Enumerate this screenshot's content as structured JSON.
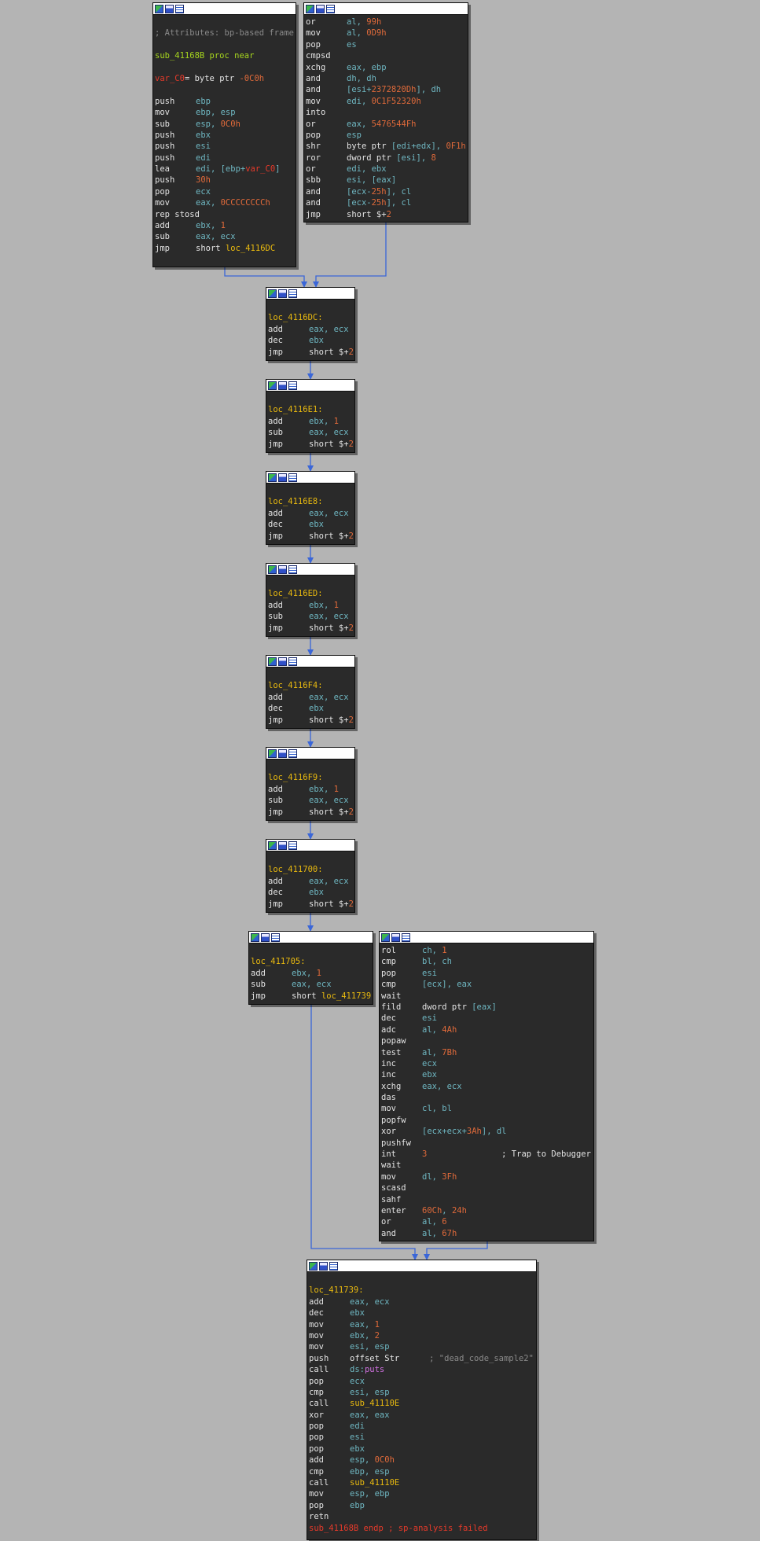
{
  "colors": {
    "background": "#b4b4b4",
    "node_bg": "#2a2a2a",
    "edge": "#3a66d8",
    "mnemonic": "#e4e4e4",
    "operand": "#6fb7c2",
    "number": "#e06a3a",
    "label": "#e8b90f",
    "comment": "#8a8a8a"
  },
  "titlebar_icons": [
    "graph-overview-icon",
    "flow-chart-icon",
    "text-view-icon"
  ],
  "blocks": {
    "entry": [
      [],
      [
        [
          "cmt",
          "; Attributes: bp-based frame"
        ]
      ],
      [],
      [
        [
          "lime",
          "sub_41168B proc near"
        ]
      ],
      [],
      [
        [
          "red",
          "var_C0"
        ],
        [
          "white",
          "= byte ptr "
        ],
        [
          "num",
          "-0C0h"
        ]
      ],
      [],
      [
        [
          "mn",
          "push"
        ],
        [
          "op",
          "ebp"
        ]
      ],
      [
        [
          "mn",
          "mov"
        ],
        [
          "op",
          "ebp, esp"
        ]
      ],
      [
        [
          "mn",
          "sub"
        ],
        [
          "op",
          "esp, "
        ],
        [
          "num",
          "0C0h"
        ]
      ],
      [
        [
          "mn",
          "push"
        ],
        [
          "op",
          "ebx"
        ]
      ],
      [
        [
          "mn",
          "push"
        ],
        [
          "op",
          "esi"
        ]
      ],
      [
        [
          "mn",
          "push"
        ],
        [
          "op",
          "edi"
        ]
      ],
      [
        [
          "mn",
          "lea"
        ],
        [
          "op",
          "edi, [ebp+"
        ],
        [
          "red",
          "var_C0"
        ],
        [
          "op",
          "]"
        ]
      ],
      [
        [
          "mn",
          "push"
        ],
        [
          "num",
          "30h"
        ]
      ],
      [
        [
          "mn",
          "pop"
        ],
        [
          "op",
          "ecx"
        ]
      ],
      [
        [
          "mn",
          "mov"
        ],
        [
          "op",
          "eax, "
        ],
        [
          "num",
          "0CCCCCCCCh"
        ]
      ],
      [
        [
          "white",
          "rep stosd"
        ]
      ],
      [
        [
          "mn",
          "add"
        ],
        [
          "op",
          "ebx, "
        ],
        [
          "num",
          "1"
        ]
      ],
      [
        [
          "mn",
          "sub"
        ],
        [
          "op",
          "eax, ecx"
        ]
      ],
      [
        [
          "mn",
          "jmp"
        ],
        [
          "white",
          "short "
        ],
        [
          "lbl",
          "loc_4116DC"
        ]
      ]
    ],
    "junk_top": [
      [
        [
          "mn",
          "or"
        ],
        [
          "op",
          "al, "
        ],
        [
          "num",
          "99h"
        ]
      ],
      [
        [
          "mn",
          "mov"
        ],
        [
          "op",
          "al, "
        ],
        [
          "num",
          "0D9h"
        ]
      ],
      [
        [
          "mn",
          "pop"
        ],
        [
          "op",
          "es"
        ]
      ],
      [
        [
          "white",
          "cmpsd"
        ]
      ],
      [
        [
          "mn",
          "xchg"
        ],
        [
          "op",
          "eax, ebp"
        ]
      ],
      [
        [
          "mn",
          "and"
        ],
        [
          "op",
          "dh, dh"
        ]
      ],
      [
        [
          "mn",
          "and"
        ],
        [
          "op",
          "[esi+"
        ],
        [
          "num",
          "2372820Dh"
        ],
        [
          "op",
          "], dh"
        ]
      ],
      [
        [
          "mn",
          "mov"
        ],
        [
          "op",
          "edi, "
        ],
        [
          "num",
          "0C1F52320h"
        ]
      ],
      [
        [
          "white",
          "into"
        ]
      ],
      [
        [
          "mn",
          "or"
        ],
        [
          "op",
          "eax, "
        ],
        [
          "num",
          "5476544Fh"
        ]
      ],
      [
        [
          "mn",
          "pop"
        ],
        [
          "op",
          "esp"
        ]
      ],
      [
        [
          "mn",
          "shr"
        ],
        [
          "white",
          "byte ptr "
        ],
        [
          "op",
          "[edi+edx], "
        ],
        [
          "num",
          "0F1h"
        ]
      ],
      [
        [
          "mn",
          "ror"
        ],
        [
          "white",
          "dword ptr "
        ],
        [
          "op",
          "[esi], "
        ],
        [
          "num",
          "8"
        ]
      ],
      [
        [
          "mn",
          "or"
        ],
        [
          "op",
          "edi, ebx"
        ]
      ],
      [
        [
          "mn",
          "sbb"
        ],
        [
          "op",
          "esi, [eax]"
        ]
      ],
      [
        [
          "mn",
          "and"
        ],
        [
          "op",
          "[ecx-"
        ],
        [
          "num",
          "25h"
        ],
        [
          "op",
          "], cl"
        ]
      ],
      [
        [
          "mn",
          "and"
        ],
        [
          "op",
          "[ecx-"
        ],
        [
          "num",
          "25h"
        ],
        [
          "op",
          "], cl"
        ]
      ],
      [
        [
          "mn",
          "jmp"
        ],
        [
          "white",
          "short $+"
        ],
        [
          "num",
          "2"
        ]
      ]
    ],
    "n_4116DC": [
      [],
      [
        [
          "lbl",
          "loc_4116DC:"
        ]
      ],
      [
        [
          "mn",
          "add"
        ],
        [
          "op",
          "eax, ecx"
        ]
      ],
      [
        [
          "mn",
          "dec"
        ],
        [
          "op",
          "ebx"
        ]
      ],
      [
        [
          "mn",
          "jmp"
        ],
        [
          "white",
          "short $+"
        ],
        [
          "num",
          "2"
        ]
      ]
    ],
    "n_4116E1": [
      [],
      [
        [
          "lbl",
          "loc_4116E1:"
        ]
      ],
      [
        [
          "mn",
          "add"
        ],
        [
          "op",
          "ebx, "
        ],
        [
          "num",
          "1"
        ]
      ],
      [
        [
          "mn",
          "sub"
        ],
        [
          "op",
          "eax, ecx"
        ]
      ],
      [
        [
          "mn",
          "jmp"
        ],
        [
          "white",
          "short $+"
        ],
        [
          "num",
          "2"
        ]
      ]
    ],
    "n_4116E8": [
      [],
      [
        [
          "lbl",
          "loc_4116E8:"
        ]
      ],
      [
        [
          "mn",
          "add"
        ],
        [
          "op",
          "eax, ecx"
        ]
      ],
      [
        [
          "mn",
          "dec"
        ],
        [
          "op",
          "ebx"
        ]
      ],
      [
        [
          "mn",
          "jmp"
        ],
        [
          "white",
          "short $+"
        ],
        [
          "num",
          "2"
        ]
      ]
    ],
    "n_4116ED": [
      [],
      [
        [
          "lbl",
          "loc_4116ED:"
        ]
      ],
      [
        [
          "mn",
          "add"
        ],
        [
          "op",
          "ebx, "
        ],
        [
          "num",
          "1"
        ]
      ],
      [
        [
          "mn",
          "sub"
        ],
        [
          "op",
          "eax, ecx"
        ]
      ],
      [
        [
          "mn",
          "jmp"
        ],
        [
          "white",
          "short $+"
        ],
        [
          "num",
          "2"
        ]
      ]
    ],
    "n_4116F4": [
      [],
      [
        [
          "lbl",
          "loc_4116F4:"
        ]
      ],
      [
        [
          "mn",
          "add"
        ],
        [
          "op",
          "eax, ecx"
        ]
      ],
      [
        [
          "mn",
          "dec"
        ],
        [
          "op",
          "ebx"
        ]
      ],
      [
        [
          "mn",
          "jmp"
        ],
        [
          "white",
          "short $+"
        ],
        [
          "num",
          "2"
        ]
      ]
    ],
    "n_4116F9": [
      [],
      [
        [
          "lbl",
          "loc_4116F9:"
        ]
      ],
      [
        [
          "mn",
          "add"
        ],
        [
          "op",
          "ebx, "
        ],
        [
          "num",
          "1"
        ]
      ],
      [
        [
          "mn",
          "sub"
        ],
        [
          "op",
          "eax, ecx"
        ]
      ],
      [
        [
          "mn",
          "jmp"
        ],
        [
          "white",
          "short $+"
        ],
        [
          "num",
          "2"
        ]
      ]
    ],
    "n_411700": [
      [],
      [
        [
          "lbl",
          "loc_411700:"
        ]
      ],
      [
        [
          "mn",
          "add"
        ],
        [
          "op",
          "eax, ecx"
        ]
      ],
      [
        [
          "mn",
          "dec"
        ],
        [
          "op",
          "ebx"
        ]
      ],
      [
        [
          "mn",
          "jmp"
        ],
        [
          "white",
          "short $+"
        ],
        [
          "num",
          "2"
        ]
      ]
    ],
    "n_411705": [
      [],
      [
        [
          "lbl",
          "loc_411705:"
        ]
      ],
      [
        [
          "mn",
          "add"
        ],
        [
          "op",
          "ebx, "
        ],
        [
          "num",
          "1"
        ]
      ],
      [
        [
          "mn",
          "sub"
        ],
        [
          "op",
          "eax, ecx"
        ]
      ],
      [
        [
          "mn",
          "jmp"
        ],
        [
          "white",
          "short "
        ],
        [
          "lbl",
          "loc_411739"
        ]
      ]
    ],
    "junk_mid": [
      [
        [
          "mn",
          "rol"
        ],
        [
          "op",
          "ch, "
        ],
        [
          "num",
          "1"
        ]
      ],
      [
        [
          "mn",
          "cmp"
        ],
        [
          "op",
          "bl, ch"
        ]
      ],
      [
        [
          "mn",
          "pop"
        ],
        [
          "op",
          "esi"
        ]
      ],
      [
        [
          "mn",
          "cmp"
        ],
        [
          "op",
          "[ecx], eax"
        ]
      ],
      [
        [
          "white",
          "wait"
        ]
      ],
      [
        [
          "mn",
          "fild"
        ],
        [
          "white",
          "dword ptr "
        ],
        [
          "op",
          "[eax]"
        ]
      ],
      [
        [
          "mn",
          "dec"
        ],
        [
          "op",
          "esi"
        ]
      ],
      [
        [
          "mn",
          "adc"
        ],
        [
          "op",
          "al, "
        ],
        [
          "num",
          "4Ah"
        ]
      ],
      [
        [
          "white",
          "popaw"
        ]
      ],
      [
        [
          "mn",
          "test"
        ],
        [
          "op",
          "al, "
        ],
        [
          "num",
          "7Bh"
        ]
      ],
      [
        [
          "mn",
          "inc"
        ],
        [
          "op",
          "ecx"
        ]
      ],
      [
        [
          "mn",
          "inc"
        ],
        [
          "op",
          "ebx"
        ]
      ],
      [
        [
          "mn",
          "xchg"
        ],
        [
          "op",
          "eax, ecx"
        ]
      ],
      [
        [
          "white",
          "das"
        ]
      ],
      [
        [
          "mn",
          "mov"
        ],
        [
          "op",
          "cl, bl"
        ]
      ],
      [
        [
          "white",
          "popfw"
        ]
      ],
      [
        [
          "mn",
          "xor"
        ],
        [
          "op",
          "[ecx+ecx+"
        ],
        [
          "num",
          "3Ah"
        ],
        [
          "op",
          "], dl"
        ]
      ],
      [
        [
          "white",
          "pushfw"
        ]
      ],
      [
        [
          "mn",
          "int"
        ],
        [
          "num",
          "3               "
        ],
        [
          "white",
          "; Trap to Debugger"
        ]
      ],
      [
        [
          "white",
          "wait"
        ]
      ],
      [
        [
          "mn",
          "mov"
        ],
        [
          "op",
          "dl, "
        ],
        [
          "num",
          "3Fh"
        ]
      ],
      [
        [
          "white",
          "scasd"
        ]
      ],
      [
        [
          "white",
          "sahf"
        ]
      ],
      [
        [
          "mn",
          "enter"
        ],
        [
          "num",
          "60Ch"
        ],
        [
          "op",
          ", "
        ],
        [
          "num",
          "24h"
        ]
      ],
      [
        [
          "mn",
          "or"
        ],
        [
          "op",
          "al, "
        ],
        [
          "num",
          "6"
        ]
      ],
      [
        [
          "mn",
          "and"
        ],
        [
          "op",
          "al, "
        ],
        [
          "num",
          "67h"
        ]
      ]
    ],
    "n_411739": [
      [],
      [
        [
          "lbl",
          "loc_411739:"
        ]
      ],
      [
        [
          "mn",
          "add"
        ],
        [
          "op",
          "eax, ecx"
        ]
      ],
      [
        [
          "mn",
          "dec"
        ],
        [
          "op",
          "ebx"
        ]
      ],
      [
        [
          "mn",
          "mov"
        ],
        [
          "op",
          "eax, "
        ],
        [
          "num",
          "1"
        ]
      ],
      [
        [
          "mn",
          "mov"
        ],
        [
          "op",
          "ebx, "
        ],
        [
          "num",
          "2"
        ]
      ],
      [
        [
          "mn",
          "mov"
        ],
        [
          "op",
          "esi, esp"
        ]
      ],
      [
        [
          "mn",
          "push"
        ],
        [
          "white",
          "offset Str      "
        ],
        [
          "cmt",
          "; \"dead_code_sample2\""
        ]
      ],
      [
        [
          "mn",
          "call"
        ],
        [
          "op",
          "ds:"
        ],
        [
          "purple",
          "puts"
        ]
      ],
      [
        [
          "mn",
          "pop"
        ],
        [
          "op",
          "ecx"
        ]
      ],
      [
        [
          "mn",
          "cmp"
        ],
        [
          "op",
          "esi, esp"
        ]
      ],
      [
        [
          "mn",
          "call"
        ],
        [
          "lbl",
          "sub_41110E"
        ]
      ],
      [
        [
          "mn",
          "xor"
        ],
        [
          "op",
          "eax, eax"
        ]
      ],
      [
        [
          "mn",
          "pop"
        ],
        [
          "op",
          "edi"
        ]
      ],
      [
        [
          "mn",
          "pop"
        ],
        [
          "op",
          "esi"
        ]
      ],
      [
        [
          "mn",
          "pop"
        ],
        [
          "op",
          "ebx"
        ]
      ],
      [
        [
          "mn",
          "add"
        ],
        [
          "op",
          "esp, "
        ],
        [
          "num",
          "0C0h"
        ]
      ],
      [
        [
          "mn",
          "cmp"
        ],
        [
          "op",
          "ebp, esp"
        ]
      ],
      [
        [
          "mn",
          "call"
        ],
        [
          "lbl",
          "sub_41110E"
        ]
      ],
      [
        [
          "mn",
          "mov"
        ],
        [
          "op",
          "esp, ebp"
        ]
      ],
      [
        [
          "mn",
          "pop"
        ],
        [
          "op",
          "ebp"
        ]
      ],
      [
        [
          "white",
          "retn"
        ]
      ],
      [
        [
          "red",
          "sub_41168B endp ; sp-analysis failed"
        ]
      ]
    ]
  }
}
